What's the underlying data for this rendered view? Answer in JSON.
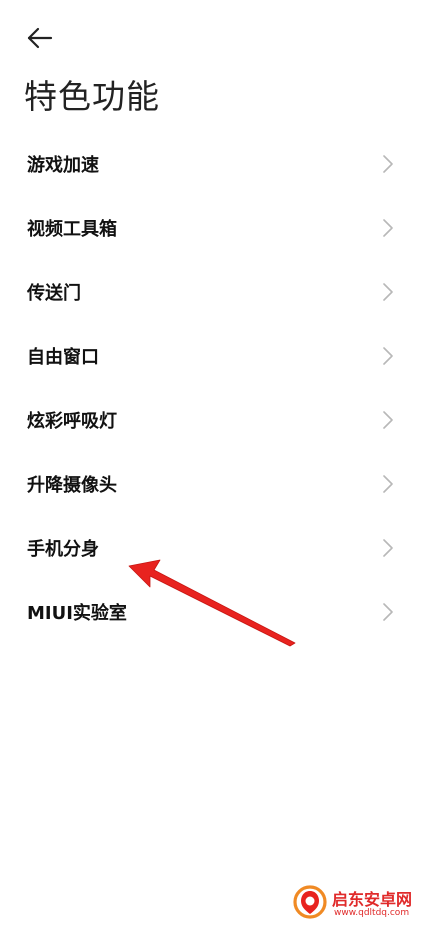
{
  "header": {
    "back_icon": "arrow-left-icon",
    "title": "特色功能"
  },
  "menu": {
    "items": [
      {
        "label": "游戏加速"
      },
      {
        "label": "视频工具箱"
      },
      {
        "label": "传送门"
      },
      {
        "label": "自由窗口"
      },
      {
        "label": "炫彩呼吸灯"
      },
      {
        "label": "升降摄像头"
      },
      {
        "label": "手机分身"
      },
      {
        "label": "MIUI实验室"
      }
    ],
    "chevron_icon": "chevron-right-icon"
  },
  "annotation": {
    "arrow_color": "#e8231f",
    "points_to": "手机分身"
  },
  "watermark": {
    "title": "启东安卓网",
    "url": "www.qdltdq.com",
    "color": "#e02a2a"
  },
  "colors": {
    "background": "#ffffff",
    "text_primary": "#111111",
    "title": "#222222",
    "chevron": "#b8b8b8"
  }
}
